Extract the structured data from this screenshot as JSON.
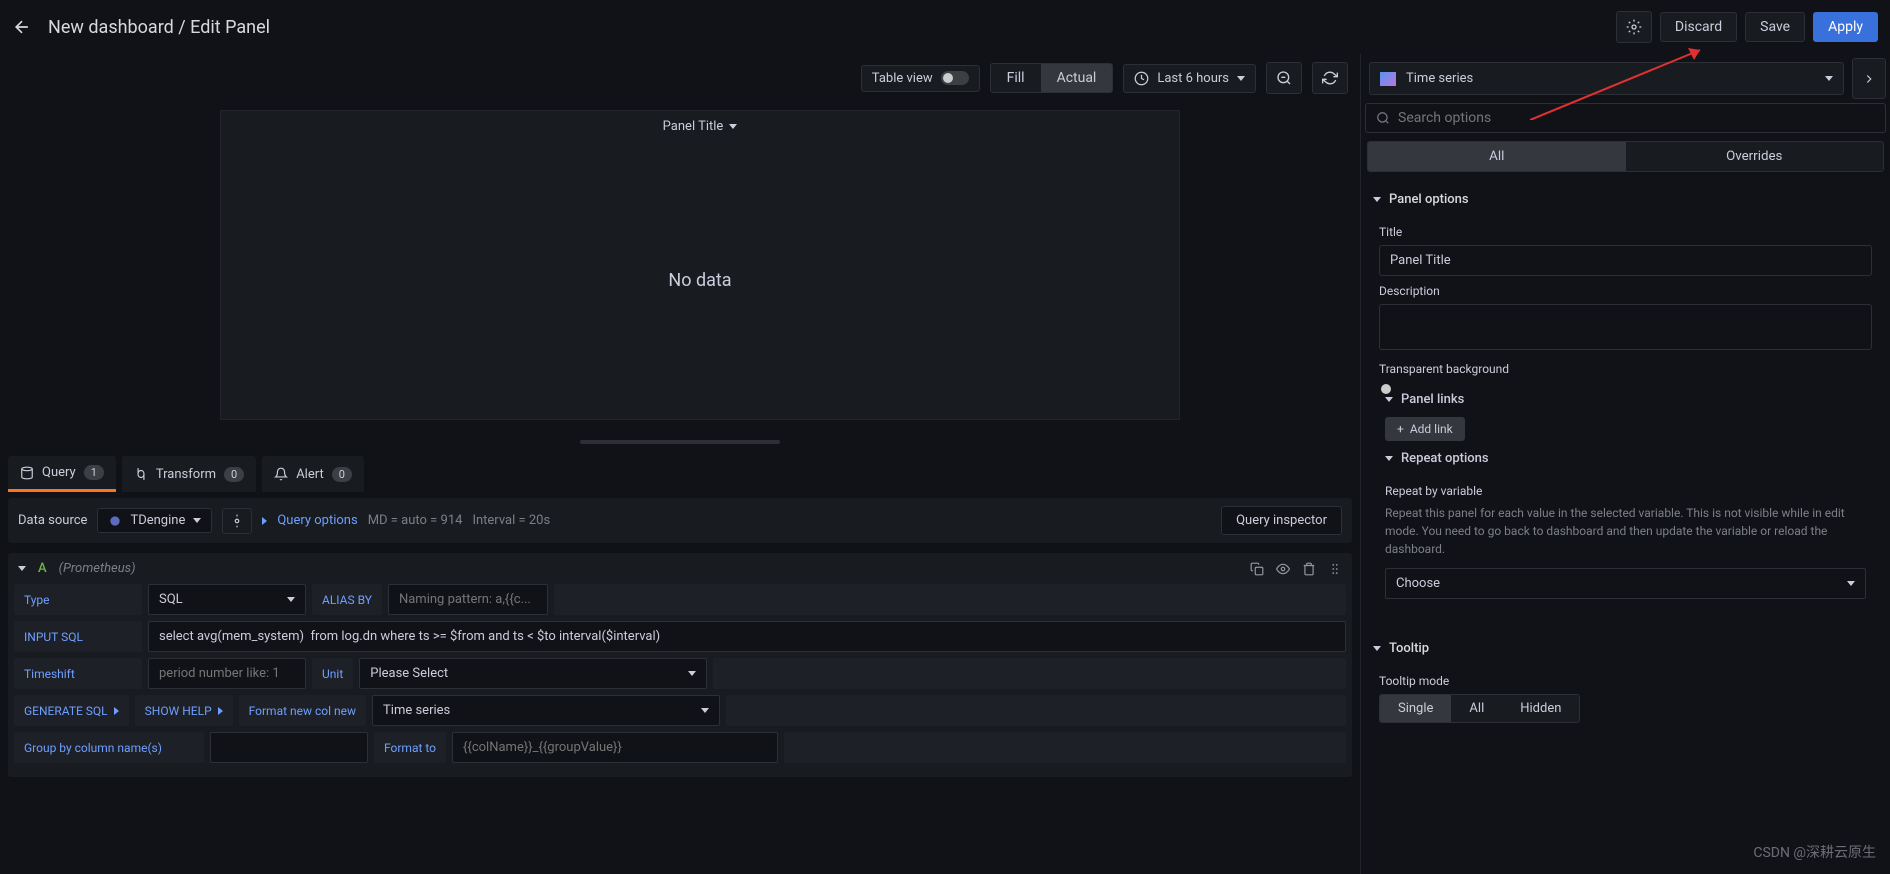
{
  "header": {
    "breadcrumb": "New dashboard / Edit Panel",
    "discard": "Discard",
    "save": "Save",
    "apply": "Apply"
  },
  "toolbar": {
    "table_view": "Table view",
    "fill": "Fill",
    "actual": "Actual",
    "time_range": "Last 6 hours"
  },
  "preview": {
    "title": "Panel Title",
    "no_data": "No data"
  },
  "tabs": {
    "query": "Query",
    "query_count": "1",
    "transform": "Transform",
    "transform_count": "0",
    "alert": "Alert",
    "alert_count": "0"
  },
  "query_toolbar": {
    "data_source_label": "Data source",
    "data_source_value": "TDengine",
    "query_options": "Query options",
    "md_info": "MD = auto = 914",
    "interval_info": "Interval = 20s",
    "inspector": "Query inspector"
  },
  "query": {
    "letter": "A",
    "name": "(Prometheus)",
    "labels": {
      "type": "Type",
      "alias_by": "ALIAS BY",
      "input_sql": "INPUT SQL",
      "timeshift": "Timeshift",
      "unit": "Unit",
      "generate_sql": "GENERATE SQL",
      "show_help": "SHOW HELP",
      "format_new": "Format new col new",
      "group_by": "Group by column name(s)",
      "format_to": "Format to"
    },
    "values": {
      "type": "SQL",
      "alias_placeholder": "Naming pattern: a,{{c...",
      "sql": "select avg(mem_system)  from log.dn where ts >= $from and ts < $to interval($interval)",
      "timeshift_placeholder": "period number like: 1",
      "unit_select": "Please Select",
      "format_select": "Time series",
      "format_to_placeholder": "{{colName}}_{{groupValue}}"
    }
  },
  "viz": {
    "type": "Time series",
    "search_placeholder": "Search options",
    "tab_all": "All",
    "tab_overrides": "Overrides"
  },
  "panel_options": {
    "heading": "Panel options",
    "title_label": "Title",
    "title_value": "Panel Title",
    "description_label": "Description",
    "transparent_label": "Transparent background"
  },
  "panel_links": {
    "heading": "Panel links",
    "add_link": "Add link"
  },
  "repeat": {
    "heading": "Repeat options",
    "label": "Repeat by variable",
    "help": "Repeat this panel for each value in the selected variable. This is not visible while in edit mode. You need to go back to dashboard and then update the variable or reload the dashboard.",
    "choose": "Choose"
  },
  "tooltip": {
    "heading": "Tooltip",
    "mode_label": "Tooltip mode",
    "single": "Single",
    "all": "All",
    "hidden": "Hidden"
  },
  "watermark": "CSDN @深耕云原生"
}
